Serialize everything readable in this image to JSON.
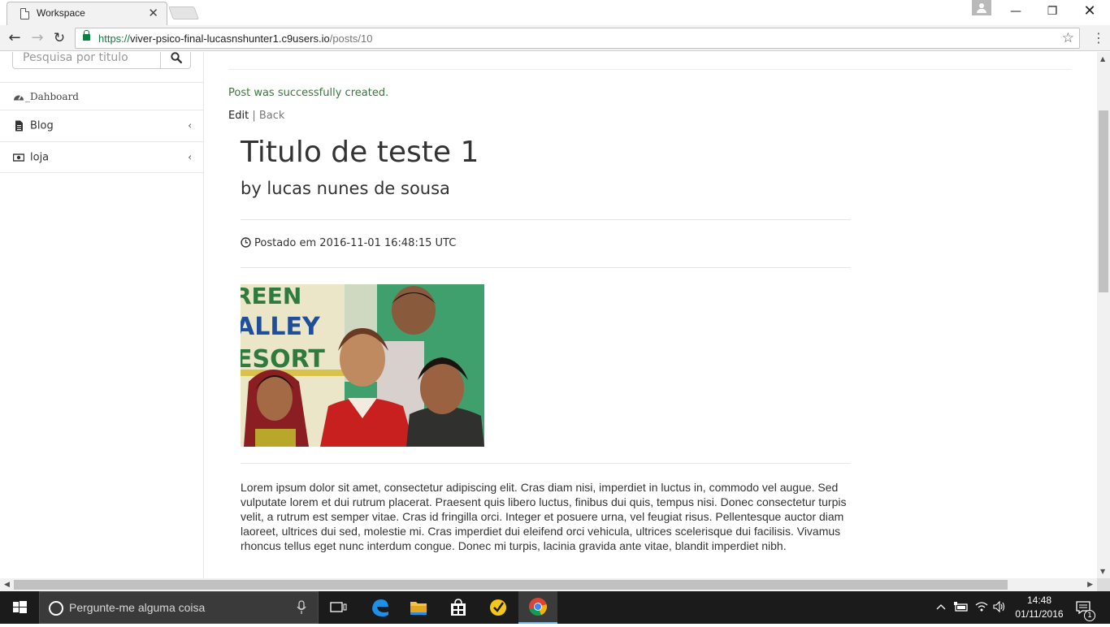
{
  "browser": {
    "tab_title": "Workspace",
    "url_scheme": "https://",
    "url_host": "viver-psico-final-lucasnshunter1.c9users.io",
    "url_path": "/posts/10"
  },
  "sidebar": {
    "search_placeholder": "Pesquisa por titulo",
    "items": [
      {
        "label": "_Dahboard",
        "icon": "dashboard-icon"
      },
      {
        "label": "Blog",
        "icon": "file-icon"
      },
      {
        "label": "loja",
        "icon": "money-icon"
      }
    ]
  },
  "page": {
    "notice": "Post was successfully created.",
    "edit_label": "Edit",
    "separator": "|",
    "back_label": "Back",
    "notice_color": "#3c763d"
  },
  "post": {
    "title": "Titulo de teste 1",
    "author": "by lucas nunes de sousa",
    "posted": "Postado em 2016-11-01 16:48:15 UTC",
    "image_sign_text": "REEN\nALLEY\nESORT",
    "body": "Lorem ipsum dolor sit amet, consectetur adipiscing elit. Cras diam nisi, imperdiet in luctus in, commodo vel augue. Sed vulputate lorem et dui rutrum placerat. Praesent quis libero luctus, finibus dui quis, tempus nisi. Donec consectetur turpis velit, a rutrum est semper vitae. Cras id fringilla orci. Integer et posuere urna, vel feugiat risus. Pellentesque auctor diam laoreet, ultrices dui sed, molestie mi. Cras imperdiet dui eleifend orci vehicula, ultrices scelerisque dui facilisis. Vivamus rhoncus tellus eget nunc interdum congue. Donec mi turpis, lacinia gravida ante vitae, blandit imperdiet nibh."
  },
  "taskbar": {
    "search_placeholder": "Pergunte-me alguma coisa",
    "time": "14:48",
    "date": "01/11/2016",
    "notification_count": "1"
  }
}
